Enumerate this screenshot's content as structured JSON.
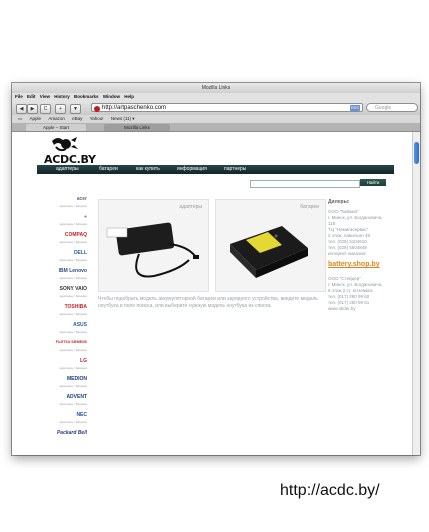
{
  "window": {
    "title": "Mozilla Links"
  },
  "menu": [
    "File",
    "Edit",
    "View",
    "History",
    "Bookmarks",
    "Window",
    "Help"
  ],
  "toolbar": {
    "back": "◀",
    "forward": "▶",
    "reload": "C",
    "add": "+",
    "download": "▼",
    "url": "http://artpaschenko.com",
    "rss": "RSS",
    "search_placeholder": "Google"
  },
  "bookmarks": [
    "Apple",
    "Amazon",
    "eBay",
    "Yahoo!",
    "News (11) ▾"
  ],
  "tabs": [
    "Apple – Start",
    "Mozilla Links"
  ],
  "site": {
    "logo": "ACDC.BY",
    "nav": [
      "адаптеры",
      "батареи",
      "как купить",
      "информация",
      "партнеры"
    ],
    "search_button": "Найти",
    "brands": [
      {
        "name": "acer",
        "color": "#5b6f7f",
        "sub": "адаптеры \\ батареи"
      },
      {
        "name": "",
        "color": "#8b8b8b",
        "sub": "адаптеры \\ батареи"
      },
      {
        "name": "COMPAQ",
        "color": "#c0252a",
        "sub": "адаптеры \\ батареи"
      },
      {
        "name": "DELL",
        "color": "#2b5ea9",
        "sub": "адаптеры \\ батареи"
      },
      {
        "name": "IBM Lenovo",
        "color": "#2b4d86",
        "sub": "адаптеры \\ батареи"
      },
      {
        "name": "SONY VAIO",
        "color": "#333333",
        "sub": "адаптеры \\ батареи"
      },
      {
        "name": "TOSHIBA",
        "color": "#c8242b",
        "sub": "адаптеры \\ батареи"
      },
      {
        "name": "ASUS",
        "color": "#2a5ea8",
        "sub": "адаптеры \\ батареи"
      },
      {
        "name": "FUJITSU SIEMENS",
        "color": "#c0252a",
        "sub": "адаптеры \\ батареи"
      },
      {
        "name": "LG",
        "color": "#b8263a",
        "sub": "адаптеры \\ батареи"
      },
      {
        "name": "MEDION",
        "color": "#1e3a78",
        "sub": "адаптеры \\ батареи"
      },
      {
        "name": "ADVENT",
        "color": "#1f3e7c",
        "sub": "адаптеры \\ батареи"
      },
      {
        "name": "NEC",
        "color": "#1e4fa3",
        "sub": "адаптеры \\ батареи"
      },
      {
        "name": "Packard Bell",
        "color": "#2b3a8a",
        "sub": ""
      }
    ],
    "cards": [
      {
        "title": "адаптеры"
      },
      {
        "title": "батареи"
      }
    ],
    "description": "Чтобы подобрать модель аккумуляторной батареи или зарядного устройства, введите модель ноутбука в поле поиска, или выберите нужную модель ноутбука из списка.",
    "right": {
      "heading": "Дилеры:",
      "dealer1": [
        "ООО \"Кайамп\"",
        "г. Минск, ул. Богдановича,",
        "118",
        "ТЦ \"Немигасервис\"",
        "2 этаж, павильон 48",
        "тел. (029) 5104610",
        "тел. (029) 5504848",
        "интернет-магазин:"
      ],
      "shop": "battery.shop.by",
      "dealer2": [
        "ООО \"Стейдер\"",
        "г. Минск, ул. Богдановича,",
        "8 этаж 2 ст. м.Немига",
        "тел. (017) 280 99 60",
        "тел. (017) 280 99 61",
        "www.stider.by"
      ]
    }
  },
  "caption": "http://acdc.by/"
}
